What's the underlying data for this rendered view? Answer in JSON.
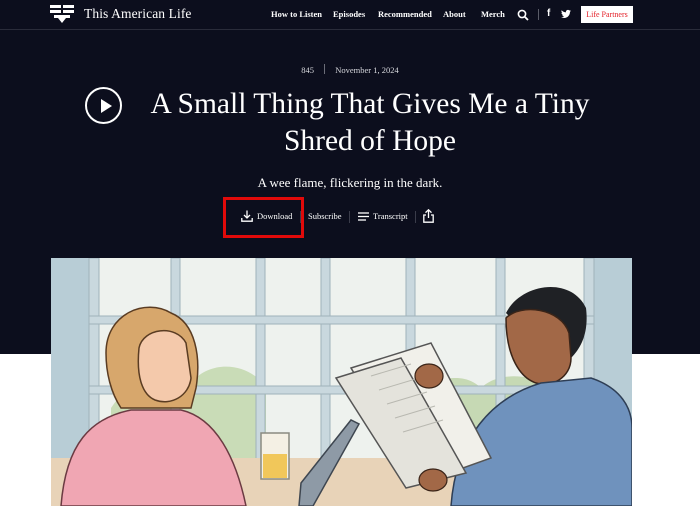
{
  "site": {
    "brand": "This American Life",
    "nav": [
      "How to Listen",
      "Episodes",
      "Recommended",
      "About",
      "Merch"
    ],
    "life_partners": "Life Partners",
    "facebook_glyph": "f"
  },
  "episode": {
    "number": "845",
    "date": "November 1, 2024",
    "title_line1": "A Small Thing That Gives Me a Tiny",
    "title_line2": "Shred of Hope",
    "subtitle": "A wee flame, flickering in the dark."
  },
  "actions": {
    "download": "Download",
    "subscribe": "Subscribe",
    "transcript": "Transcript"
  },
  "colors": {
    "hero_bg": "#0c0e1d",
    "accent_red": "#e4222a",
    "highlight_red": "#e10a0a"
  }
}
